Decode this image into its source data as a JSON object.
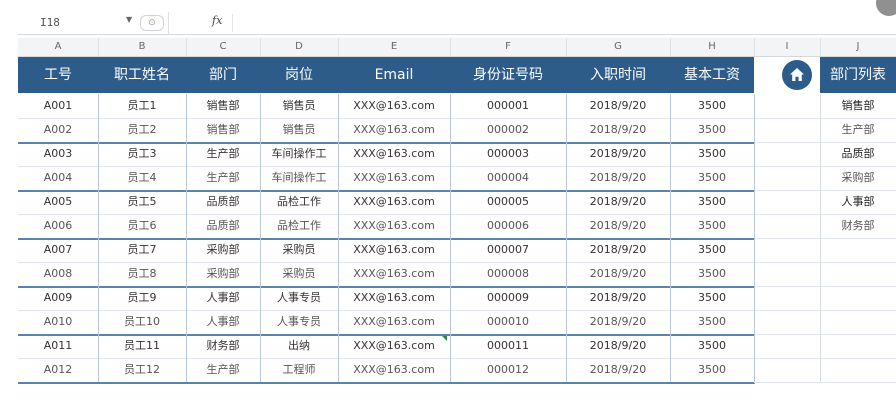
{
  "formula_bar": {
    "name_box": "I18",
    "fx_label": "fx",
    "formula": ""
  },
  "columns": [
    "A",
    "B",
    "C",
    "D",
    "E",
    "F",
    "G",
    "H",
    "I",
    "J"
  ],
  "headers": {
    "emp_id": "工号",
    "name": "职工姓名",
    "dept": "部门",
    "position": "岗位",
    "email": "Email",
    "id_no": "身份证号码",
    "hire_date": "入职时间",
    "salary": "基本工资",
    "home_icon": "home-icon",
    "dept_list": "部门列表"
  },
  "rows": [
    {
      "id": "A001",
      "name": "员工1",
      "dept": "销售部",
      "position": "销售员",
      "email": "XXX@163.com",
      "idno": "000001",
      "date": "2018/9/20",
      "salary": "3500",
      "side": "销售部"
    },
    {
      "id": "A002",
      "name": "员工2",
      "dept": "销售部",
      "position": "销售员",
      "email": "XXX@163.com",
      "idno": "000002",
      "date": "2018/9/20",
      "salary": "3500",
      "side": "生产部"
    },
    {
      "id": "A003",
      "name": "员工3",
      "dept": "生产部",
      "position": "车间操作工",
      "email": "XXX@163.com",
      "idno": "000003",
      "date": "2018/9/20",
      "salary": "3500",
      "side": "品质部"
    },
    {
      "id": "A004",
      "name": "员工4",
      "dept": "生产部",
      "position": "车间操作工",
      "email": "XXX@163.com",
      "idno": "000004",
      "date": "2018/9/20",
      "salary": "3500",
      "side": "采购部"
    },
    {
      "id": "A005",
      "name": "员工5",
      "dept": "品质部",
      "position": "品检工作",
      "email": "XXX@163.com",
      "idno": "000005",
      "date": "2018/9/20",
      "salary": "3500",
      "side": "人事部"
    },
    {
      "id": "A006",
      "name": "员工6",
      "dept": "品质部",
      "position": "品检工作",
      "email": "XXX@163.com",
      "idno": "000006",
      "date": "2018/9/20",
      "salary": "3500",
      "side": "财务部"
    },
    {
      "id": "A007",
      "name": "员工7",
      "dept": "采购部",
      "position": "采购员",
      "email": "XXX@163.com",
      "idno": "000007",
      "date": "2018/9/20",
      "salary": "3500",
      "side": ""
    },
    {
      "id": "A008",
      "name": "员工8",
      "dept": "采购部",
      "position": "采购员",
      "email": "XXX@163.com",
      "idno": "000008",
      "date": "2018/9/20",
      "salary": "3500",
      "side": ""
    },
    {
      "id": "A009",
      "name": "员工9",
      "dept": "人事部",
      "position": "人事专员",
      "email": "XXX@163.com",
      "idno": "000009",
      "date": "2018/9/20",
      "salary": "3500",
      "side": ""
    },
    {
      "id": "A010",
      "name": "员工10",
      "dept": "人事部",
      "position": "人事专员",
      "email": "XXX@163.com",
      "idno": "000010",
      "date": "2018/9/20",
      "salary": "3500",
      "side": ""
    },
    {
      "id": "A011",
      "name": "员工11",
      "dept": "财务部",
      "position": "出纳",
      "email": "XXX@163.com",
      "idno": "000011",
      "date": "2018/9/20",
      "salary": "3500",
      "side": ""
    },
    {
      "id": "A012",
      "name": "员工12",
      "dept": "生产部",
      "position": "工程师",
      "email": "XXX@163.com",
      "idno": "000012",
      "date": "2018/9/20",
      "salary": "3500",
      "side": ""
    }
  ],
  "colors": {
    "header_bg": "#2e5c8a",
    "header_text": "#ffffff",
    "group_border": "#5b84ad",
    "cell_mark": "#2f8a3d"
  }
}
